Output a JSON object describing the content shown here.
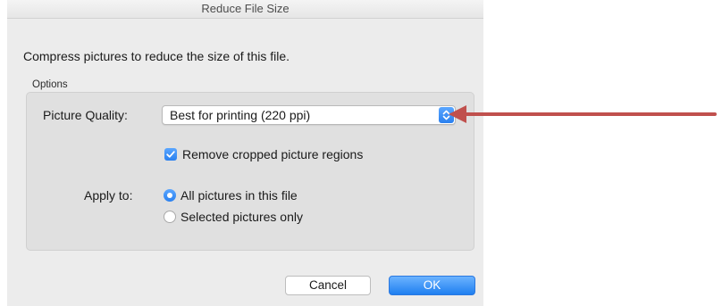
{
  "window": {
    "title": "Reduce File Size"
  },
  "intro_text": "Compress pictures to reduce the size of this file.",
  "options_group": {
    "label": "Options",
    "picture_quality": {
      "label": "Picture Quality:",
      "selected_value": "Best for printing (220 ppi)"
    },
    "remove_cropped": {
      "label": "Remove cropped picture regions",
      "checked": true
    },
    "apply_to": {
      "label": "Apply to:",
      "options": [
        {
          "label": "All pictures in this file",
          "selected": true
        },
        {
          "label": "Selected pictures only",
          "selected": false
        }
      ]
    }
  },
  "buttons": {
    "cancel": "Cancel",
    "ok": "OK"
  },
  "colors": {
    "accent": "#2a80ef",
    "annotation_arrow": "#c0504d"
  }
}
